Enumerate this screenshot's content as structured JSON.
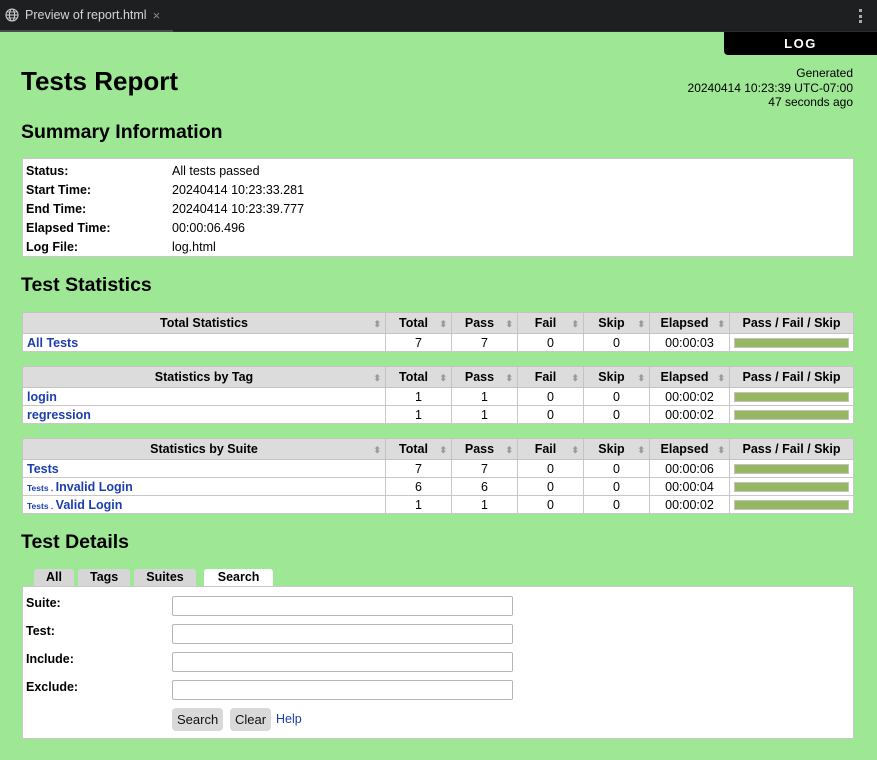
{
  "window": {
    "tab_title": "Preview of report.html",
    "tab_icon": "globe-icon",
    "close_glyph": "×",
    "menu_icon": "kebab-menu-icon"
  },
  "header": {
    "log_link": "LOG",
    "title": "Tests Report",
    "generated_label": "Generated",
    "generated_time": "20240414 10:23:39 UTC-07:00",
    "generated_ago": "47 seconds ago"
  },
  "summary": {
    "heading": "Summary Information",
    "rows": [
      {
        "label": "Status:",
        "value": "All tests passed"
      },
      {
        "label": "Start Time:",
        "value": "20240414 10:23:33.281"
      },
      {
        "label": "End Time:",
        "value": "20240414 10:23:39.777"
      },
      {
        "label": "Elapsed Time:",
        "value": "00:00:06.496"
      },
      {
        "label": "Log File:",
        "value": "log.html"
      }
    ],
    "status_color": "#1a8a1a"
  },
  "statistics": {
    "heading": "Test Statistics",
    "columns": [
      "Total",
      "Pass",
      "Fail",
      "Skip",
      "Elapsed",
      "Pass / Fail / Skip"
    ],
    "sort_glyph": "⬍",
    "total": {
      "title": "Total Statistics",
      "rows": [
        {
          "name": "All Tests",
          "parent": "",
          "total": "7",
          "pass": "7",
          "fail": "0",
          "skip": "0",
          "elapsed": "00:00:03",
          "pass_frac": 1,
          "fail_frac": 0,
          "skip_frac": 0
        }
      ]
    },
    "tag": {
      "title": "Statistics by Tag",
      "rows": [
        {
          "name": "login",
          "parent": "",
          "total": "1",
          "pass": "1",
          "fail": "0",
          "skip": "0",
          "elapsed": "00:00:02",
          "pass_frac": 1,
          "fail_frac": 0,
          "skip_frac": 0
        },
        {
          "name": "regression",
          "parent": "",
          "total": "1",
          "pass": "1",
          "fail": "0",
          "skip": "0",
          "elapsed": "00:00:02",
          "pass_frac": 1,
          "fail_frac": 0,
          "skip_frac": 0
        }
      ]
    },
    "suite": {
      "title": "Statistics by Suite",
      "rows": [
        {
          "name": "Tests",
          "parent": "",
          "total": "7",
          "pass": "7",
          "fail": "0",
          "skip": "0",
          "elapsed": "00:00:06",
          "pass_frac": 1,
          "fail_frac": 0,
          "skip_frac": 0
        },
        {
          "name": "Invalid Login",
          "parent": "Tests . ",
          "total": "6",
          "pass": "6",
          "fail": "0",
          "skip": "0",
          "elapsed": "00:00:04",
          "pass_frac": 1,
          "fail_frac": 0,
          "skip_frac": 0
        },
        {
          "name": "Valid Login",
          "parent": "Tests . ",
          "total": "1",
          "pass": "1",
          "fail": "0",
          "skip": "0",
          "elapsed": "00:00:02",
          "pass_frac": 1,
          "fail_frac": 0,
          "skip_frac": 0
        }
      ]
    }
  },
  "details": {
    "heading": "Test Details",
    "tabs": [
      {
        "label": "All",
        "active": false
      },
      {
        "label": "Tags",
        "active": false
      },
      {
        "label": "Suites",
        "active": false
      },
      {
        "label": "Search",
        "active": true
      }
    ],
    "fields": [
      {
        "label": "Suite:",
        "value": ""
      },
      {
        "label": "Test:",
        "value": ""
      },
      {
        "label": "Include:",
        "value": ""
      },
      {
        "label": "Exclude:",
        "value": ""
      }
    ],
    "search_button": "Search",
    "clear_button": "Clear",
    "help_link": "Help"
  },
  "colors": {
    "background": "#9ee794",
    "pass_bar": "#97b760",
    "link": "#1b3fae"
  }
}
